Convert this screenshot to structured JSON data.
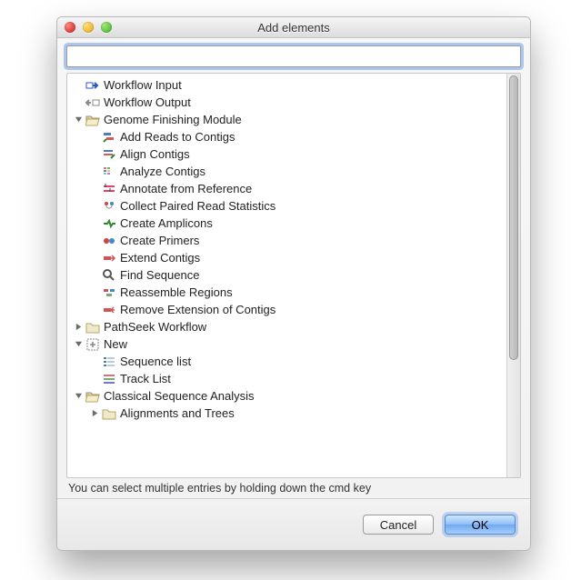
{
  "window": {
    "title": "Add elements"
  },
  "search": {
    "value": "",
    "placeholder": ""
  },
  "hint": "You can select multiple entries by holding down the cmd key",
  "buttons": {
    "cancel": "Cancel",
    "ok": "OK"
  },
  "tree": [
    {
      "indent": 1,
      "arrow": "none",
      "icon": "workflow-input",
      "label": "Workflow Input"
    },
    {
      "indent": 1,
      "arrow": "none",
      "icon": "workflow-output",
      "label": "Workflow Output"
    },
    {
      "indent": 1,
      "arrow": "open",
      "icon": "folder-open",
      "label": "Genome Finishing Module"
    },
    {
      "indent": 2,
      "arrow": "none",
      "icon": "add-reads",
      "label": "Add Reads to Contigs"
    },
    {
      "indent": 2,
      "arrow": "none",
      "icon": "align",
      "label": "Align Contigs"
    },
    {
      "indent": 2,
      "arrow": "none",
      "icon": "analyze",
      "label": "Analyze Contigs"
    },
    {
      "indent": 2,
      "arrow": "none",
      "icon": "annotate",
      "label": "Annotate from Reference"
    },
    {
      "indent": 2,
      "arrow": "none",
      "icon": "collect",
      "label": "Collect Paired Read Statistics"
    },
    {
      "indent": 2,
      "arrow": "none",
      "icon": "amplicons",
      "label": "Create Amplicons"
    },
    {
      "indent": 2,
      "arrow": "none",
      "icon": "primers",
      "label": "Create Primers"
    },
    {
      "indent": 2,
      "arrow": "none",
      "icon": "extend",
      "label": "Extend Contigs"
    },
    {
      "indent": 2,
      "arrow": "none",
      "icon": "find",
      "label": "Find Sequence"
    },
    {
      "indent": 2,
      "arrow": "none",
      "icon": "reassemble",
      "label": "Reassemble Regions"
    },
    {
      "indent": 2,
      "arrow": "none",
      "icon": "remove-ext",
      "label": "Remove Extension of Contigs"
    },
    {
      "indent": 1,
      "arrow": "closed",
      "icon": "folder",
      "label": "PathSeek Workflow"
    },
    {
      "indent": 1,
      "arrow": "open",
      "icon": "new",
      "label": "New"
    },
    {
      "indent": 2,
      "arrow": "none",
      "icon": "seqlist",
      "label": "Sequence list"
    },
    {
      "indent": 2,
      "arrow": "none",
      "icon": "tracklist",
      "label": "Track List"
    },
    {
      "indent": 1,
      "arrow": "open",
      "icon": "folder-open",
      "label": "Classical Sequence Analysis"
    },
    {
      "indent": 2,
      "arrow": "closed",
      "icon": "folder",
      "label": "Alignments and Trees"
    }
  ]
}
